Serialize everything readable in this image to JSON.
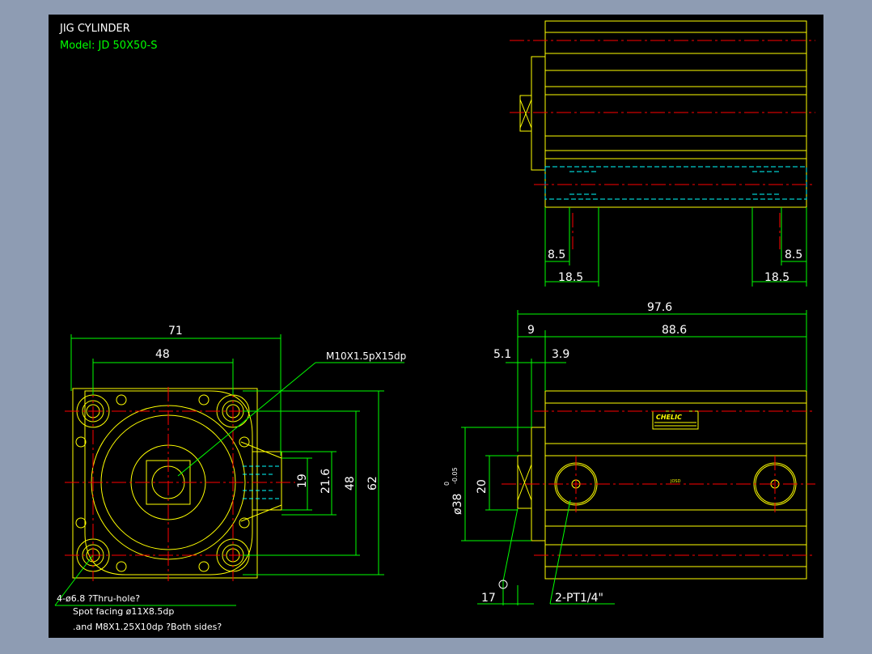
{
  "title": "JIG CYLINDER",
  "model": "Model: JD 50X50-S",
  "colors": {
    "background": "#000000",
    "frame": "#8e9cb3",
    "outline": "#ffff00",
    "dimension": "#00ff00",
    "centerline": "#ff0000",
    "hidden": "#00ffff",
    "text": "#ffffff"
  },
  "dimensions": {
    "front_width_71": "71",
    "front_width_48": "48",
    "front_height_62": "62",
    "front_height_48": "48",
    "front_height_21_6": "21.6",
    "front_height_19": "19",
    "side_len_97_6": "97.6",
    "side_len_9": "9",
    "side_len_88_6": "88.6",
    "side_len_5_1": "5.1",
    "side_len_3_9": "3.9",
    "side_h_20": "20",
    "side_dia_38": "ø38",
    "side_tol_upper": "0",
    "side_tol_lower": "-0.05",
    "side_17": "17",
    "top_8_5_left": "8.5",
    "top_8_5_right": "8.5",
    "top_18_5_left": "18.5",
    "top_18_5_right": "18.5"
  },
  "notes": {
    "thread_callout": "M10X1.5pX15dp",
    "port_callout": "2-PT1/4\"",
    "hole_line1": "4-ø6.8    ?Thru-hole?",
    "hole_line2": "Spot facing  ø11X8.5dp",
    "hole_line3": ".and M8X1.25X10dp ?Both sides?",
    "logo": "CHELIC",
    "side_center_mark": "JOSD"
  }
}
